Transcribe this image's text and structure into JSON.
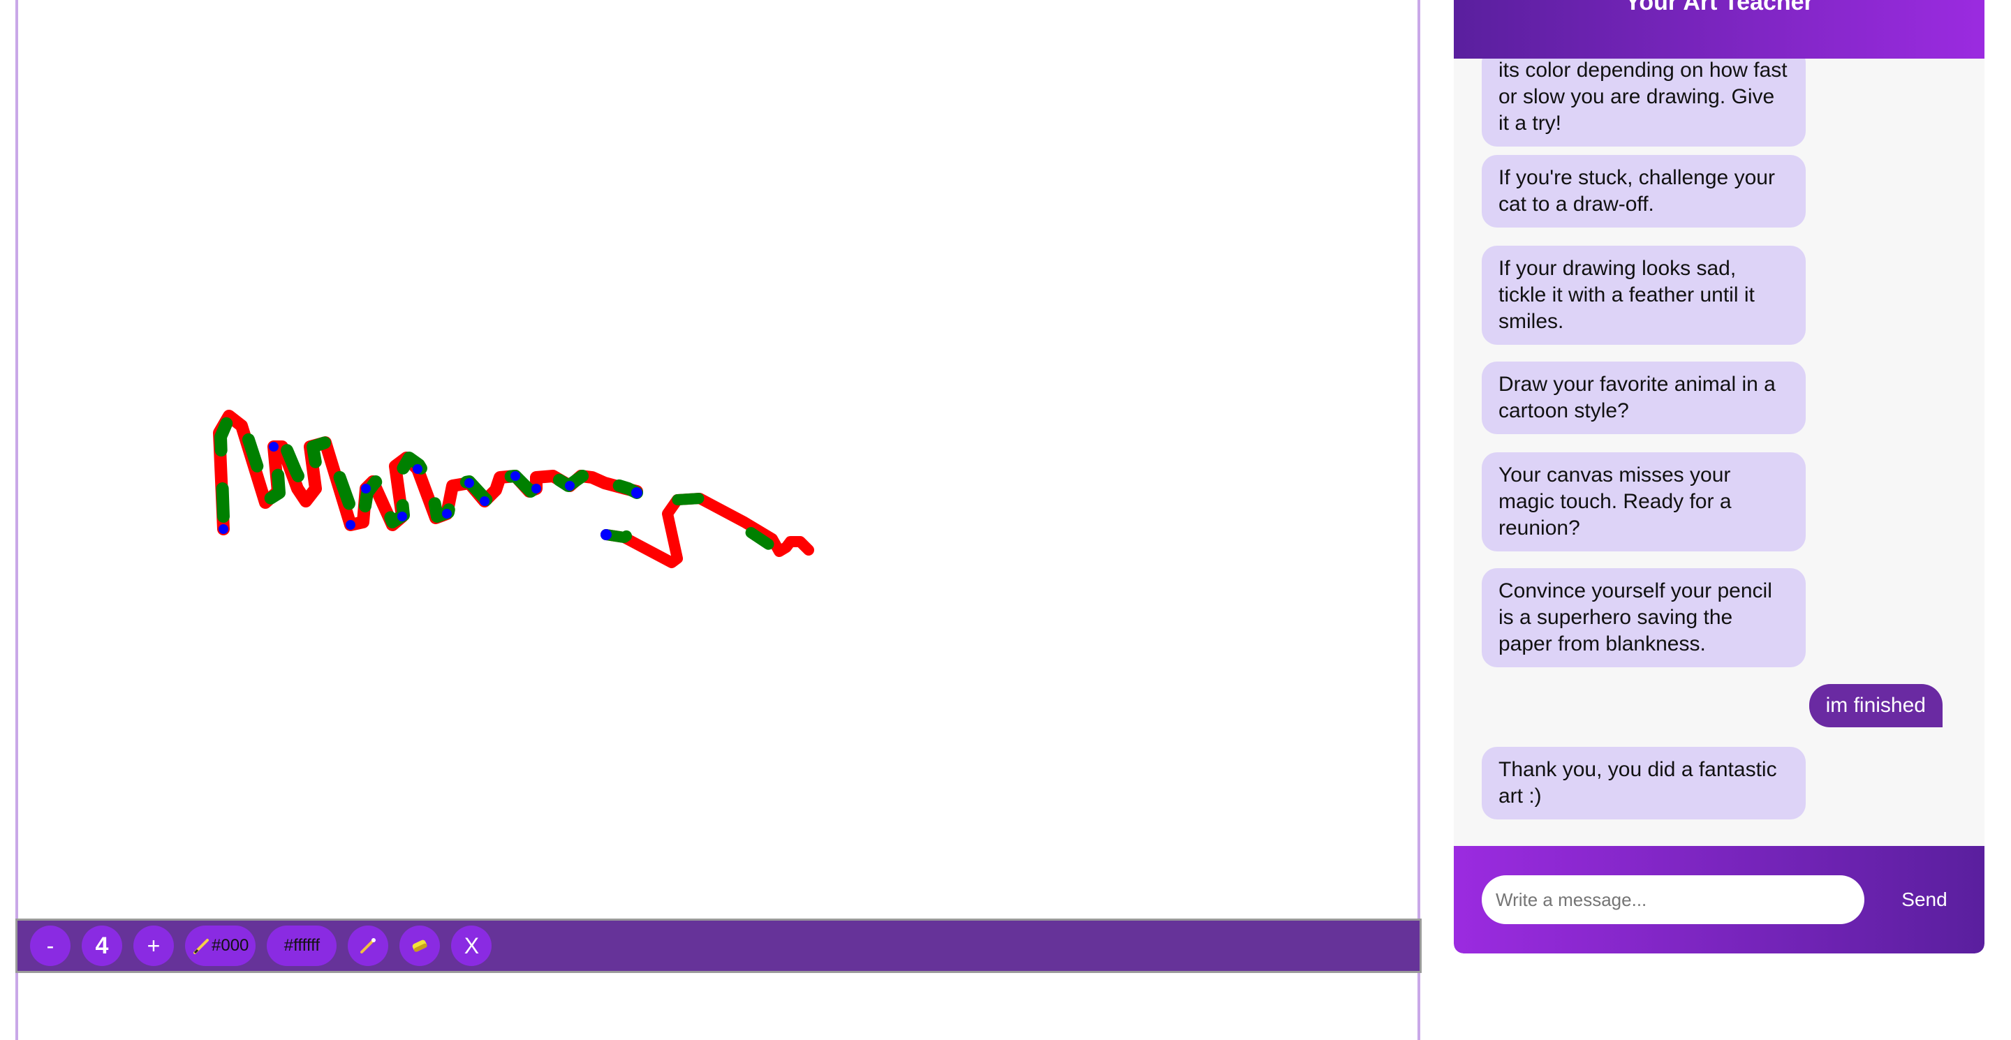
{
  "toolbar": {
    "decrease_label": "-",
    "brush_size": "4",
    "increase_label": "+",
    "brush_color_text": "#000",
    "background_color_text": "#ffffff",
    "close_label": "X"
  },
  "chat": {
    "title": "Your Art Teacher",
    "messages": [
      {
        "from": "teacher",
        "text": "its color depending on how fast or slow you are drawing. Give it a try!"
      },
      {
        "from": "teacher",
        "text": "If you're stuck, challenge your cat to a draw-off."
      },
      {
        "from": "teacher",
        "text": "If your drawing looks sad, tickle it with a feather until it smiles."
      },
      {
        "from": "teacher",
        "text": "Draw your favorite animal in a cartoon style?"
      },
      {
        "from": "teacher",
        "text": "Your canvas misses your magic touch. Ready for a reunion?"
      },
      {
        "from": "teacher",
        "text": "Convince yourself your pencil is a superhero saving the paper from blankness."
      },
      {
        "from": "user",
        "text": "im finished"
      },
      {
        "from": "teacher",
        "text": "Thank you, you did a fantastic art :)"
      }
    ],
    "input_placeholder": "Write a message...",
    "send_label": "Send"
  },
  "colors": {
    "accent": "#8a2be2",
    "toolbar_bg": "#663399",
    "bubble": "#ddd3f7",
    "stroke_red": "#ff0000",
    "stroke_green": "#008000",
    "stroke_blue": "#0000ff"
  }
}
